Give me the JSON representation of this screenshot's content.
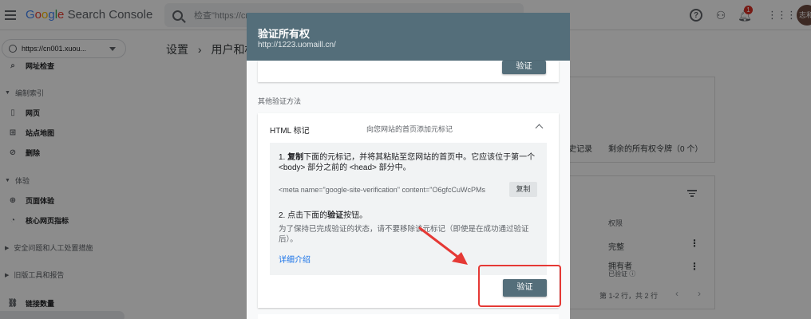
{
  "topbar": {
    "logo_google": [
      "G",
      "o",
      "o",
      "g",
      "l",
      "e"
    ],
    "logo_product": "Search Console",
    "search_placeholder": "检查\"https://cn",
    "notification_count": "1",
    "avatar_text": "志和"
  },
  "sidebar": {
    "property": "https://cn001.xuou...",
    "items": [
      {
        "label": "网址检查",
        "icon": "search-icon"
      },
      {
        "label": "编制索引",
        "type": "section"
      },
      {
        "label": "网页",
        "icon": "page-icon"
      },
      {
        "label": "站点地图",
        "icon": "sitemap-icon"
      },
      {
        "label": "删除",
        "icon": "remove-icon"
      },
      {
        "label": "体验",
        "type": "section"
      },
      {
        "label": "页面体验",
        "icon": "plus-circle-icon"
      },
      {
        "label": "核心网页指标",
        "icon": "gauge-icon"
      },
      {
        "label": "安全问题和人工处置措施",
        "type": "section"
      },
      {
        "label": "旧版工具和报告",
        "type": "section"
      },
      {
        "label": "链接数量",
        "icon": "links-icon"
      }
    ]
  },
  "main": {
    "breadcrumb_root": "设置",
    "breadcrumb_sep": "›",
    "breadcrumb_current": "用户和权",
    "history_label": "史记录",
    "remaining_tokens": "剩余的所有权令牌（0 个）",
    "permissions_header": "权限",
    "rows": [
      {
        "permission": "完整",
        "sub": ""
      },
      {
        "permission": "拥有者",
        "sub": "已验证 ⓘ"
      }
    ],
    "pagination": "第 1-2 行，共 2 行"
  },
  "dialog": {
    "title": "验证所有权",
    "url": "http://1223.uomaill.cn/",
    "verify_top_label": "验证",
    "other_methods_label": "其他验证方法",
    "method": {
      "title": "HTML 标记",
      "description": "向您网站的首页添加元标记",
      "step1_prefix": "1. ",
      "step1_bold": "复制",
      "step1_text": "下面的元标记，并将其粘贴至您网站的首页中。它应该位于第一个 <body> 部分之前的 <head> 部分中。",
      "meta_tag": "<meta name=\"google-site-verification\" content=\"O6gfcCuWcPMs",
      "copy_label": "复制",
      "step2_prefix": "2. 点击下面的",
      "step2_bold": "验证",
      "step2_suffix": "按钮。",
      "keep_note": "为了保持已完成验证的状态，请不要移除该元标记（即使是在成功通过验证后）。",
      "learn_more": "详细介绍",
      "verify_label": "验证"
    }
  },
  "colors": {
    "dialog_header": "#546e7a",
    "annotation": "#e53935",
    "link": "#1a73e8"
  }
}
